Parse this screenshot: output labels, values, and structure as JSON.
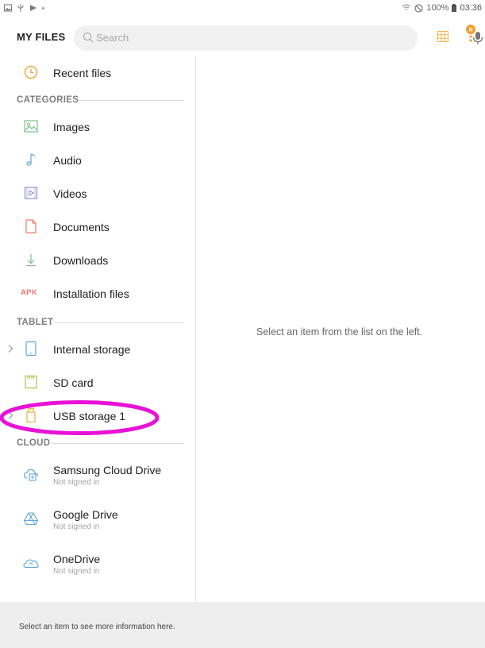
{
  "status_bar": {
    "battery": "100%",
    "time": "03:36"
  },
  "header": {
    "title": "MY FILES",
    "search_placeholder": "Search"
  },
  "sidebar": {
    "recent": {
      "label": "Recent files",
      "icon": "clock-icon"
    },
    "categories_heading": "CATEGORIES",
    "categories": [
      {
        "label": "Images",
        "icon": "image-icon"
      },
      {
        "label": "Audio",
        "icon": "music-note-icon"
      },
      {
        "label": "Videos",
        "icon": "video-icon"
      },
      {
        "label": "Documents",
        "icon": "document-icon"
      },
      {
        "label": "Downloads",
        "icon": "download-icon"
      },
      {
        "label": "Installation files",
        "icon_text": "APK"
      }
    ],
    "tablet_heading": "TABLET",
    "tablet": [
      {
        "label": "Internal storage",
        "icon": "tablet-icon"
      },
      {
        "label": "SD card",
        "icon": "sd-card-icon"
      },
      {
        "label": "USB storage 1",
        "icon": "usb-icon"
      }
    ],
    "cloud_heading": "CLOUD",
    "cloud": [
      {
        "label": "Samsung Cloud Drive",
        "status": "Not signed in",
        "icon": "samsung-cloud-icon"
      },
      {
        "label": "Google Drive",
        "status": "Not signed in",
        "icon": "google-drive-icon"
      },
      {
        "label": "OneDrive",
        "status": "Not signed in",
        "icon": "onedrive-icon"
      }
    ]
  },
  "main": {
    "empty_message": "Select an item from the list on the left."
  },
  "footer": {
    "message": "Select an item to see more information here."
  },
  "colors": {
    "accent_orange": "#f39c2c",
    "annotation_magenta": "#e812d6",
    "icon_green": "#7cc08a",
    "icon_blue": "#5fa8d8"
  }
}
